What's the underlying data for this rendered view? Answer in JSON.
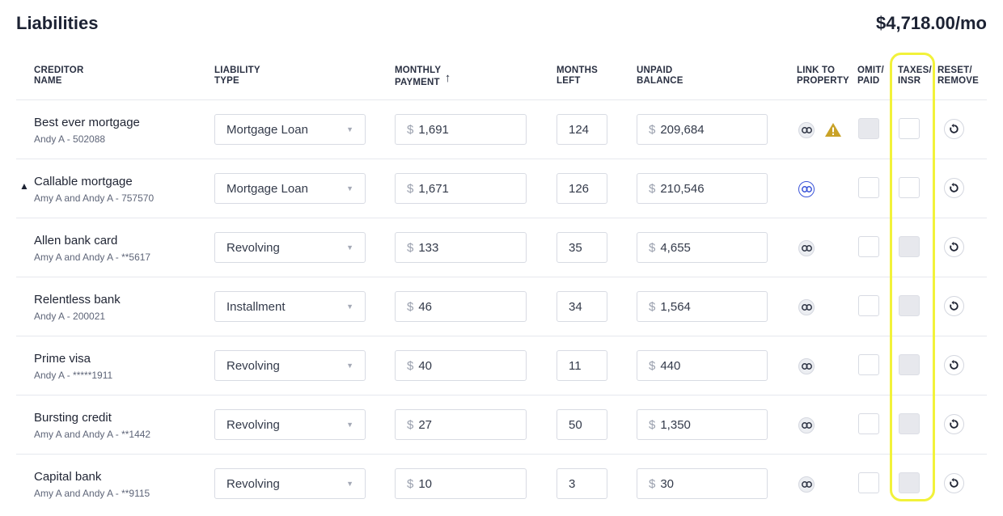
{
  "title": "Liabilities",
  "total": "$4,718.00/mo",
  "columns": {
    "creditor": [
      "CREDITOR",
      "NAME"
    ],
    "type": [
      "LIABILITY",
      "TYPE"
    ],
    "payment": [
      "MONTHLY",
      "PAYMENT"
    ],
    "payment_sort": "↑",
    "months": [
      "MONTHS",
      "LEFT"
    ],
    "balance": [
      "UNPAID",
      "BALANCE"
    ],
    "link": [
      "LINK TO",
      "PROPERTY"
    ],
    "omit": [
      "OMIT/",
      "PAID"
    ],
    "taxes": [
      "TAXES/",
      "INSR"
    ],
    "reset": [
      "RESET/",
      "REMOVE"
    ]
  },
  "currency_symbol": "$",
  "colors": {
    "highlight": "#f2f23a",
    "link_active": "#3b55d9",
    "warning": "#c9a227"
  },
  "rows": [
    {
      "name": "Best ever mortgage",
      "sub": "Andy A - 502088",
      "type": "Mortgage Loan",
      "payment": "1,691",
      "months": "124",
      "balance": "209,684",
      "link_active": false,
      "warning": true,
      "home": false,
      "omit_disabled": true,
      "taxes_disabled": false
    },
    {
      "name": "Callable mortgage",
      "sub": "Amy A and Andy A - 757570",
      "type": "Mortgage Loan",
      "payment": "1,671",
      "months": "126",
      "balance": "210,546",
      "link_active": true,
      "warning": false,
      "home": true,
      "omit_disabled": false,
      "taxes_disabled": false
    },
    {
      "name": "Allen bank card",
      "sub": "Amy A and Andy A - **5617",
      "type": "Revolving",
      "payment": "133",
      "months": "35",
      "balance": "4,655",
      "link_active": false,
      "warning": false,
      "home": false,
      "omit_disabled": false,
      "taxes_disabled": true
    },
    {
      "name": "Relentless bank",
      "sub": "Andy A - 200021",
      "type": "Installment",
      "payment": "46",
      "months": "34",
      "balance": "1,564",
      "link_active": false,
      "warning": false,
      "home": false,
      "omit_disabled": false,
      "taxes_disabled": true
    },
    {
      "name": "Prime visa",
      "sub": "Andy A - *****1911",
      "type": "Revolving",
      "payment": "40",
      "months": "11",
      "balance": "440",
      "link_active": false,
      "warning": false,
      "home": false,
      "omit_disabled": false,
      "taxes_disabled": true
    },
    {
      "name": "Bursting credit",
      "sub": "Amy A and Andy A - **1442",
      "type": "Revolving",
      "payment": "27",
      "months": "50",
      "balance": "1,350",
      "link_active": false,
      "warning": false,
      "home": false,
      "omit_disabled": false,
      "taxes_disabled": true
    },
    {
      "name": "Capital bank",
      "sub": "Amy A and Andy A - **9115",
      "type": "Revolving",
      "payment": "10",
      "months": "3",
      "balance": "30",
      "link_active": false,
      "warning": false,
      "home": false,
      "omit_disabled": false,
      "taxes_disabled": true
    }
  ]
}
